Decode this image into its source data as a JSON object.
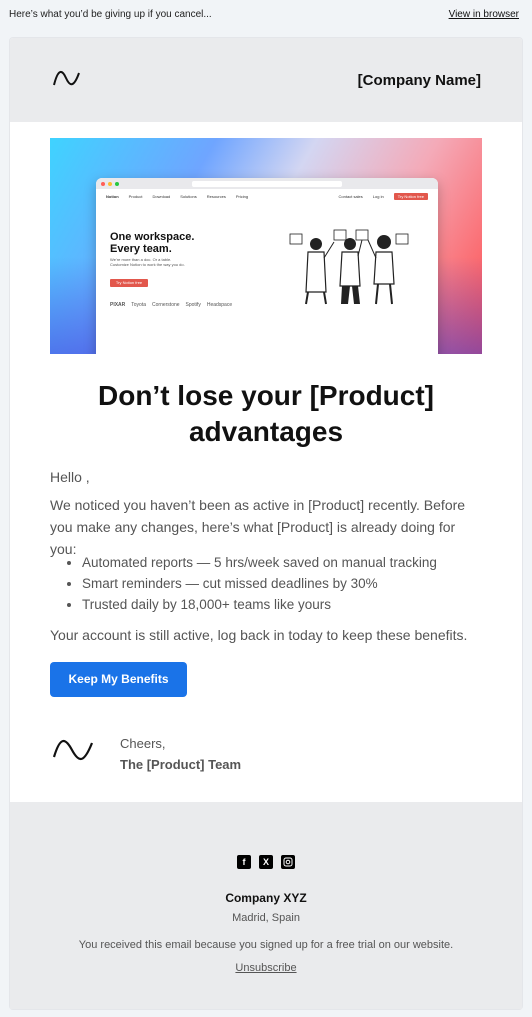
{
  "preheader": {
    "text": "Here’s what you’d be giving up if you cancel...",
    "view_browser": "View in browser"
  },
  "header": {
    "brand": "[Company Name]",
    "logo_icon": "wave-icon"
  },
  "hero": {
    "browser": {
      "nav": [
        "Notion",
        "Product",
        "Download",
        "Solutions",
        "Resources",
        "Pricing",
        "Contact sales",
        "Log in"
      ],
      "cta": "Try Notion free",
      "headline": "One workspace.\nEvery team.",
      "sub": "We’re more than a doc. Or a table. Customize Notion to work the way you do.",
      "try": "Try Notion free",
      "logos": [
        "PIXAR",
        "Toyota",
        "Cornerstone",
        "Spotify",
        "Headspace"
      ]
    }
  },
  "headline": "Don’t lose your [Product] advantages",
  "body": {
    "greeting": "Hello ,",
    "intro": "We noticed you haven’t been as active in [Product] recently. Before you make any changes, here’s what [Product] is already doing for you:",
    "bullets": [
      "Automated reports — 5 hrs/week saved on manual tracking",
      "Smart reminders — cut missed deadlines by 30%",
      "Trusted daily by 18,000+ teams like yours"
    ],
    "closing": "Your account is still active, log back in today to keep these benefits."
  },
  "cta": {
    "label": "Keep My Benefits",
    "color": "#1a73e8"
  },
  "signature": {
    "cheers": "Cheers,",
    "team": "The [Product] Team"
  },
  "footer": {
    "social": [
      "facebook-icon",
      "x-icon",
      "instagram-icon"
    ],
    "company": "Company XYZ",
    "city": "Madrid, Spain",
    "reason": "You received this email because you signed up for a free trial on our website.",
    "unsubscribe": "Unsubscribe"
  }
}
